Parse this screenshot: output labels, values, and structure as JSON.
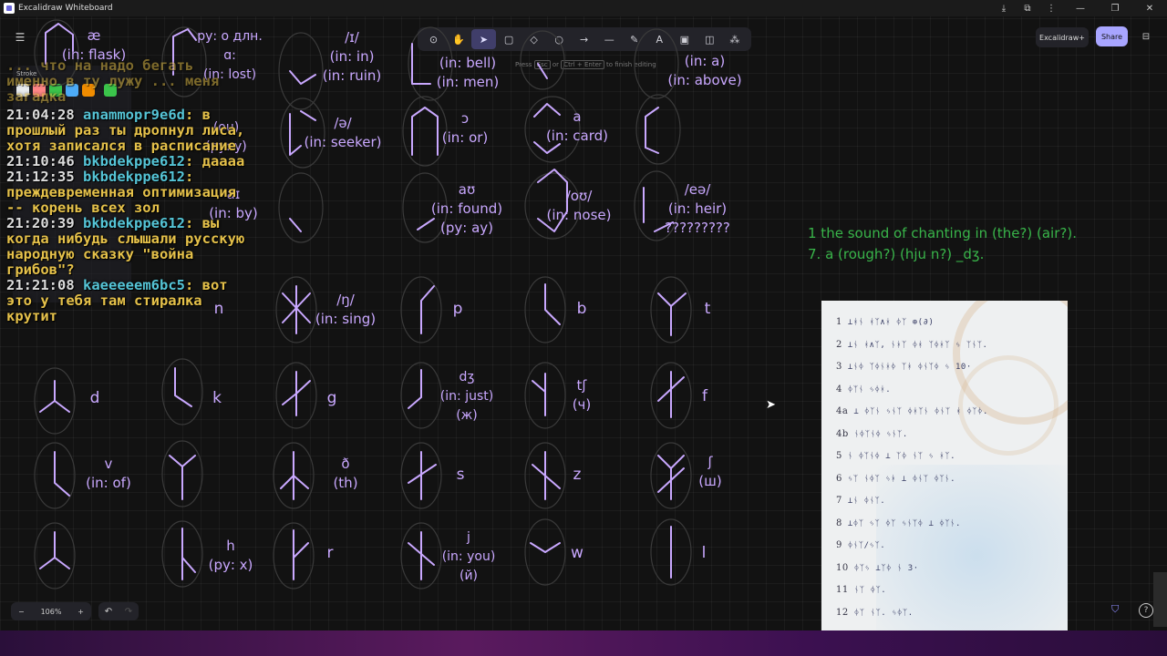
{
  "window": {
    "title": "Excalidraw Whiteboard"
  },
  "toolbar": {
    "tools": [
      {
        "name": "lock-tool",
        "glyph": "⊙"
      },
      {
        "name": "hand-tool",
        "glyph": "✋"
      },
      {
        "name": "selection-tool",
        "glyph": "➤",
        "sub": "1"
      },
      {
        "name": "rectangle-tool",
        "glyph": "▢",
        "sub": "2"
      },
      {
        "name": "diamond-tool",
        "glyph": "◇",
        "sub": "3"
      },
      {
        "name": "ellipse-tool",
        "glyph": "○",
        "sub": "4"
      },
      {
        "name": "arrow-tool",
        "glyph": "→",
        "sub": "5"
      },
      {
        "name": "line-tool",
        "glyph": "—",
        "sub": "6"
      },
      {
        "name": "draw-tool",
        "glyph": "✎",
        "sub": "7"
      },
      {
        "name": "text-tool",
        "glyph": "A",
        "sub": "8"
      },
      {
        "name": "image-tool",
        "glyph": "▣",
        "sub": "9"
      },
      {
        "name": "eraser-tool",
        "glyph": "◫",
        "sub": "0"
      },
      {
        "name": "extra-tools",
        "glyph": "⁂"
      }
    ],
    "hint_pre": "Press",
    "hint_key1": "Esc",
    "hint_mid": "or",
    "hint_key2": "Ctrl + Enter",
    "hint_post": "to finish editing"
  },
  "header": {
    "plus_label": "Excalidraw+",
    "share_label": "Share"
  },
  "props": {
    "stroke_label": "Stroke",
    "swatches": [
      "#e9ecef",
      "#ff8787",
      "#3bc44b",
      "#4dabf7",
      "#f08c00",
      "#3bc44b"
    ]
  },
  "chat": [
    {
      "time": "21:04:28",
      "user": "anammopr9e6d",
      "text": ": в прошлый раз ты дропнул лиса, хотя записался в расписание"
    },
    {
      "time": "21:10:46",
      "user": "bkbdekppe612",
      "text": ": даааа"
    },
    {
      "time": "21:12:35",
      "user": "bkbdekppe612",
      "text": ": преждевременная оптимизация -- корень всех зол"
    },
    {
      "time": "21:20:39",
      "user": "bkbdekppe612",
      "text": ": вы когда нибудь слышали русскую народную сказку \"война грибов\"?"
    },
    {
      "time": "21:21:08",
      "user": "kaeeeeem6bc5",
      "text": ": вот это у тебя там стиралка крутит"
    }
  ],
  "chat_top_text": "... что на надо бегать именно в ту лужу ... меня загадка",
  "note": {
    "line1": "1 the sound of chanting in (the?) (air?).",
    "line2": "7. a (rough?) (hju n?) _dʒ."
  },
  "glyph_labels": [
    {
      "text": "æ\n(in: flask)",
      "key": "l1"
    },
    {
      "text": "ру: о длн.\nɑ:\n(in: lost)",
      "key": "l2"
    },
    {
      "text": "/ɪ/\n(in: in)\n(in: ruin)",
      "key": "l3"
    },
    {
      "text": "(in: bell)\n(in: men)",
      "key": "l4"
    },
    {
      "text": "(in: a)\n(in: above)",
      "key": "l5"
    },
    {
      "text": "/ə/\n(in: seeker)",
      "key": "l6"
    },
    {
      "text": "ɔ\n(in: or)",
      "key": "l7"
    },
    {
      "text": "a\n(in: card)",
      "key": "l8"
    },
    {
      "text": "aɪ\n(in: by)",
      "key": "l9"
    },
    {
      "text": "aʊ\n(in: found)\n(ру: ау)",
      "key": "l10"
    },
    {
      "text": "/oʊ/\n(in: nose)",
      "key": "l11"
    },
    {
      "text": "/eə/\n(in: heir)\n?????????",
      "key": "l12"
    },
    {
      "text": "/ŋ/\n(in: sing)",
      "key": "l13"
    },
    {
      "text": "p",
      "key": "l14"
    },
    {
      "text": "b",
      "key": "l15"
    },
    {
      "text": "t",
      "key": "l16"
    },
    {
      "text": "d",
      "key": "l17"
    },
    {
      "text": "k",
      "key": "l18"
    },
    {
      "text": "g",
      "key": "l19"
    },
    {
      "text": "dʒ\n(in: just)\n(ж)",
      "key": "l20"
    },
    {
      "text": "tʃ\n(ч)",
      "key": "l21"
    },
    {
      "text": "f",
      "key": "l22"
    },
    {
      "text": "v\n(in: of)",
      "key": "l23"
    },
    {
      "text": "ð\n(th)",
      "key": "l24"
    },
    {
      "text": "s",
      "key": "l25"
    },
    {
      "text": "z",
      "key": "l26"
    },
    {
      "text": "ʃ\n(ш)",
      "key": "l27"
    },
    {
      "text": "h\n(ру: х)",
      "key": "l28"
    },
    {
      "text": "r",
      "key": "l29"
    },
    {
      "text": "j\n(in: you)\n(й)",
      "key": "l30"
    },
    {
      "text": "w",
      "key": "l31"
    },
    {
      "text": "l",
      "key": "l32"
    },
    {
      "text": "n",
      "key": "l33"
    },
    {
      "text": "(ou)\n(ру: у)",
      "key": "l34"
    }
  ],
  "paper_rows": [
    {
      "num": "1",
      "glyphs": "⊥ᚼᚾ ᚼᛉ∧ᚼ ᛄᛉ ⊕(∂)"
    },
    {
      "num": "2",
      "glyphs": "⊥ᚾ ᚼ∧ᛉ, ᚾᚼᛉ ᛄᚼ ᛉᛄᚼᛉ ᛃ ᛉᚾᛉ."
    },
    {
      "num": "3",
      "glyphs": "⊥ᚾᛄ ᛉᛄᚾᚼᛄ ᛉᚼ ᛄᚾᛉᛄ ᛃ 10·"
    },
    {
      "num": "4",
      "glyphs": "ᛄᛉᚾ ᛃᛄᚼ."
    },
    {
      "num": "4a",
      "glyphs": "⊥ ᛄᛉᚾ ᛃᚾᛉ ᛄᚼᛉᚾ ᛄᚾᛉ ᚼ ᛄᛉᛄ."
    },
    {
      "num": "4b",
      "glyphs": "ᚾᛄᛉᚾᛄ ᛃᚾᛉ."
    },
    {
      "num": "5",
      "glyphs": "ᚾ ᛄᛉᚾᛄ ⊥ ᛉᛄ ᚾᛉ ᛃ ᚼᛉ."
    },
    {
      "num": "6",
      "glyphs": "ᛃᛉ ᚾᛄᛉ ᛃᚼ ⊥ ᛄᚾᛉ ᛄᛉᚾ."
    },
    {
      "num": "7",
      "glyphs": "⊥ᚾ ᛄᚾᛉ."
    },
    {
      "num": "8",
      "glyphs": "⊥ᛄᛉ ᛃᛉ ᛄᛉ ᛃᚾᛉᛄ ⊥ ᛄᛉᚾ."
    },
    {
      "num": "9",
      "glyphs": "ᛄᚾᛉ/ᛃᛉ."
    },
    {
      "num": "10",
      "glyphs": "ᛄᛉᛃ ⊥ᛉᛄ ᚾ 3·"
    },
    {
      "num": "11",
      "glyphs": "ᚾᛉ ᛄᛉ."
    },
    {
      "num": "12",
      "glyphs": "ᛄᛉ ᚾᛉ. ᛃᛄᛉ."
    }
  ],
  "footer": {
    "zoom": "106%",
    "minus": "−",
    "plus": "+"
  }
}
